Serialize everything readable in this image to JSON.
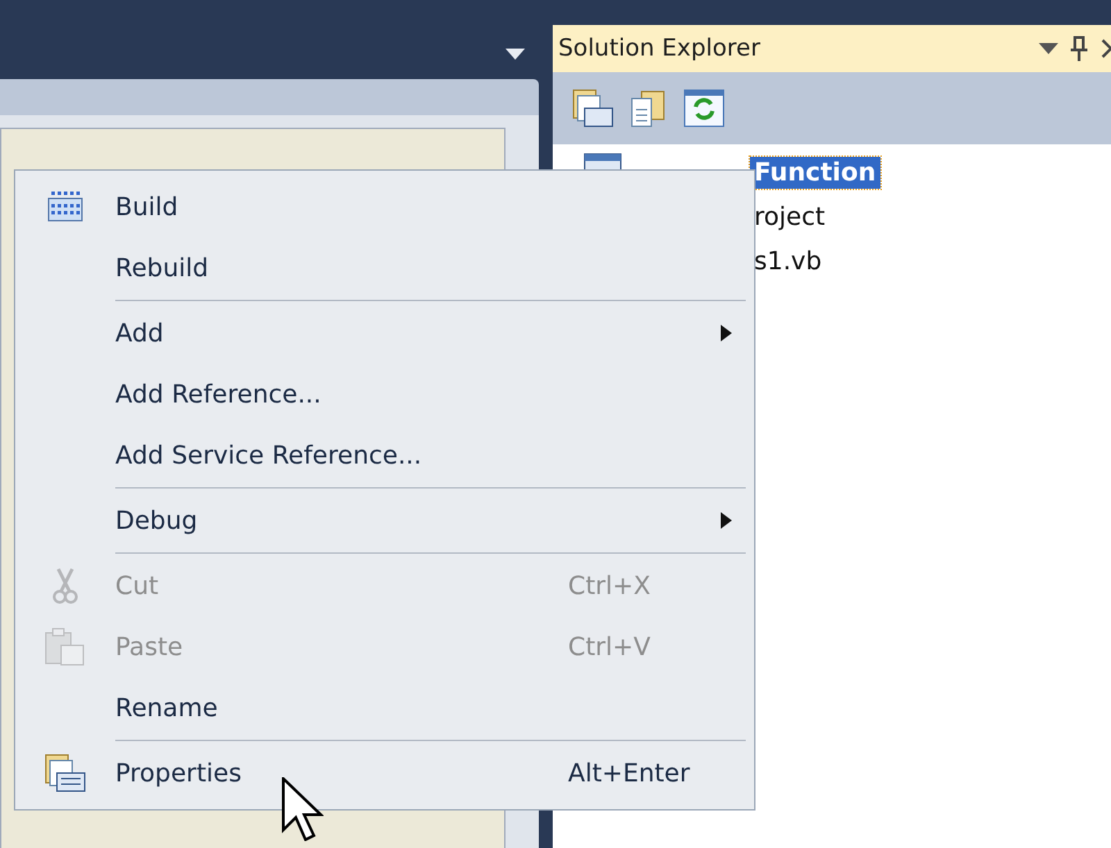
{
  "solution_explorer": {
    "title": "Solution Explorer",
    "tree": [
      {
        "label": "Function",
        "selected": true
      },
      {
        "label": "roject",
        "selected": false
      },
      {
        "label": "s1.vb",
        "selected": false
      }
    ]
  },
  "context_menu": [
    {
      "kind": "item",
      "label": "Build",
      "disabled": false
    },
    {
      "kind": "item",
      "label": "Rebuild",
      "disabled": false
    },
    {
      "kind": "separator"
    },
    {
      "kind": "submenu",
      "label": "Add",
      "disabled": false
    },
    {
      "kind": "item",
      "label": "Add Reference...",
      "disabled": false
    },
    {
      "kind": "item",
      "label": "Add Service Reference...",
      "disabled": false
    },
    {
      "kind": "separator"
    },
    {
      "kind": "submenu",
      "label": "Debug",
      "disabled": false
    },
    {
      "kind": "separator"
    },
    {
      "kind": "item",
      "label": "Cut",
      "shortcut": "Ctrl+X",
      "disabled": true
    },
    {
      "kind": "item",
      "label": "Paste",
      "shortcut": "Ctrl+V",
      "disabled": true
    },
    {
      "kind": "item",
      "label": "Rename",
      "disabled": false
    },
    {
      "kind": "separator"
    },
    {
      "kind": "item",
      "label": "Properties",
      "shortcut": "Alt+Enter",
      "disabled": false
    }
  ]
}
